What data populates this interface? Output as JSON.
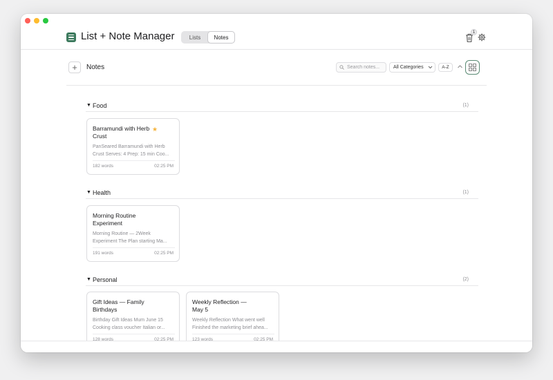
{
  "app": {
    "title": "List + Note Manager",
    "accent": "#3d7a5e",
    "icon": "list-icon"
  },
  "header": {
    "tabs": [
      {
        "label": "Lists",
        "active": false
      },
      {
        "label": "Notes",
        "active": true
      }
    ],
    "trash_count": "1"
  },
  "toolbar": {
    "add_label": "+",
    "section_title": "Notes",
    "search_placeholder": "Search notes...",
    "category_selected": "All Categories",
    "sort_label": "A-Z"
  },
  "groups": [
    {
      "name": "Food",
      "count": "(1)",
      "notes": [
        {
          "title": "Barramundi with Herb Crust",
          "starred": true,
          "preview": "PanSeared Barramundi with Herb Crust Serves: 4 Prep: 15 min Coo...",
          "words": "182 words",
          "time": "02:25 PM"
        }
      ]
    },
    {
      "name": "Health",
      "count": "(1)",
      "notes": [
        {
          "title": "Morning Routine Experiment",
          "starred": false,
          "preview": "Morning Routine — 2Week Experiment The Plan starting Ma...",
          "words": "191 words",
          "time": "02:25 PM"
        }
      ]
    },
    {
      "name": "Personal",
      "count": "(2)",
      "notes": [
        {
          "title": "Gift Ideas — Family Birthdays",
          "starred": false,
          "preview": "Birthday Gift Ideas Mum June 15 Cooking class voucher Italian or...",
          "words": "128 words",
          "time": "02:25 PM"
        },
        {
          "title": "Weekly Reflection — May 5",
          "starred": false,
          "preview": "Weekly Reflection What went well Finished the marketing brief ahea...",
          "words": "123 words",
          "time": "02:25 PM"
        }
      ]
    }
  ]
}
